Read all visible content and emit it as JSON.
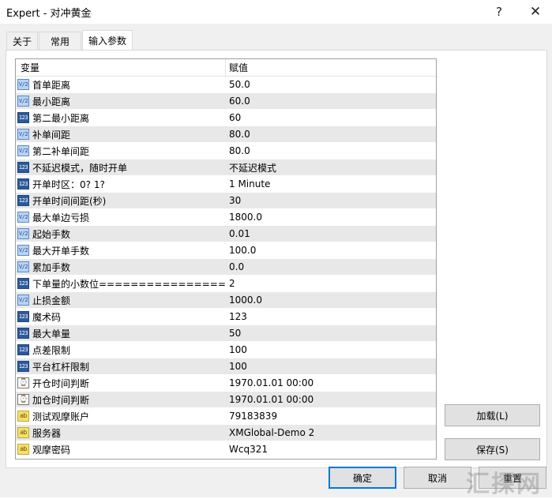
{
  "window": {
    "title": "Expert - 对冲黄金",
    "help_glyph": "?",
    "close_glyph": "✕"
  },
  "tabs": [
    {
      "label": "关于"
    },
    {
      "label": "常用"
    },
    {
      "label": "输入参数",
      "active": true
    }
  ],
  "grid": {
    "headers": {
      "variable": "变量",
      "value": "赋值"
    },
    "rows": [
      {
        "type": "real",
        "icon": "V/2",
        "name": "首单距离",
        "value": "50.0"
      },
      {
        "type": "real",
        "icon": "V/2",
        "name": "最小距离",
        "value": "60.0"
      },
      {
        "type": "int",
        "icon": "123",
        "name": "第二最小距离",
        "value": "60"
      },
      {
        "type": "real",
        "icon": "V/2",
        "name": "补单间距",
        "value": "80.0"
      },
      {
        "type": "real",
        "icon": "V/2",
        "name": "第二补单间距",
        "value": "80.0"
      },
      {
        "type": "int",
        "icon": "123",
        "name": "不延迟模式，随时开单",
        "value": "不延迟模式"
      },
      {
        "type": "int",
        "icon": "123",
        "name": "开单时区：0? 1?",
        "value": "1 Minute"
      },
      {
        "type": "int",
        "icon": "123",
        "name": "开单时间间距(秒)",
        "value": "30"
      },
      {
        "type": "real",
        "icon": "V/2",
        "name": "最大单边亏损",
        "value": "1800.0"
      },
      {
        "type": "real",
        "icon": "V/2",
        "name": "起始手数",
        "value": "0.01"
      },
      {
        "type": "real",
        "icon": "V/2",
        "name": "最大开单手数",
        "value": "100.0"
      },
      {
        "type": "real",
        "icon": "V/2",
        "name": "累加手数",
        "value": "0.0"
      },
      {
        "type": "int",
        "icon": "123",
        "name": "下单量的小数位=================?..",
        "value": "2"
      },
      {
        "type": "real",
        "icon": "V/2",
        "name": "止损金额",
        "value": "1000.0"
      },
      {
        "type": "int",
        "icon": "123",
        "name": "魔术码",
        "value": "123"
      },
      {
        "type": "int",
        "icon": "123",
        "name": "最大单量",
        "value": "50"
      },
      {
        "type": "int",
        "icon": "123",
        "name": "点差限制",
        "value": "100"
      },
      {
        "type": "int",
        "icon": "123",
        "name": "平台杠杆限制",
        "value": "100"
      },
      {
        "type": "time",
        "icon": "⌚",
        "name": "开仓时间判断",
        "value": "1970.01.01 00:00"
      },
      {
        "type": "time",
        "icon": "⌚",
        "name": "加仓时间判断",
        "value": "1970.01.01 00:00"
      },
      {
        "type": "str",
        "icon": "ab",
        "name": "测试观摩账户",
        "value": "79183839"
      },
      {
        "type": "str",
        "icon": "ab",
        "name": "服务器",
        "value": "XMGlobal-Demo 2"
      },
      {
        "type": "str",
        "icon": "ab",
        "name": "观摩密码",
        "value": "Wcq321"
      }
    ]
  },
  "buttons": {
    "load": "加载(L)",
    "save": "保存(S)",
    "ok": "确定",
    "cancel": "取消",
    "reset": "重置"
  },
  "watermark": "汇探网"
}
